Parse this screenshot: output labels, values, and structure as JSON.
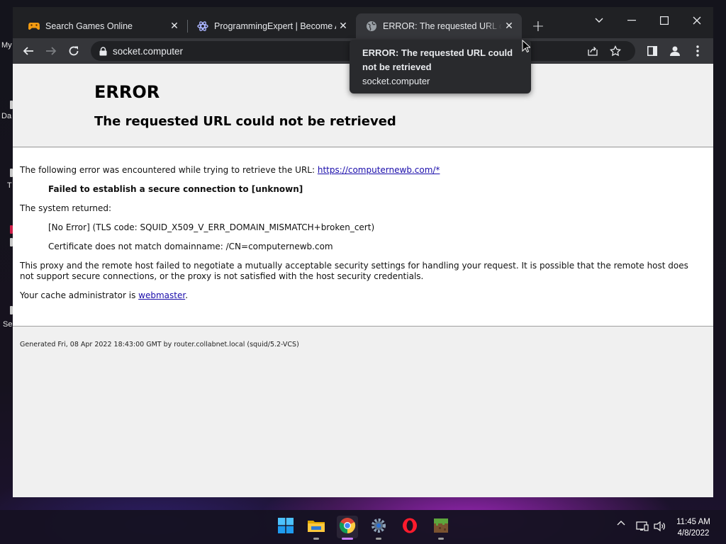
{
  "desktop": {
    "icons": [
      {
        "label": "My"
      },
      {
        "label": "Da"
      },
      {
        "label": "T"
      },
      {
        "label": "Se"
      }
    ]
  },
  "browser": {
    "tabs": [
      {
        "title": "Search Games Online",
        "icon": "gamepad-icon",
        "active": false
      },
      {
        "title": "ProgrammingExpert | Become A",
        "icon": "programmingexpert-logo-icon",
        "active": false
      },
      {
        "title": "ERROR: The requested URL could",
        "icon": "globe-icon",
        "active": true
      }
    ],
    "address_bar": {
      "url": "socket.computer"
    },
    "tooltip": {
      "title": "ERROR: The requested URL could not be retrieved",
      "url": "socket.computer"
    }
  },
  "page": {
    "heading": "ERROR",
    "subheading": "The requested URL could not be retrieved",
    "intro_text": "The following error was encountered while trying to retrieve the URL: ",
    "intro_link": "https://computernewb.com/*",
    "error_title": "Failed to establish a secure connection to [unknown]",
    "system_returned": "The system returned:",
    "tls_error": "[No Error] (TLS code: SQUID_X509_V_ERR_DOMAIN_MISMATCH+broken_cert)",
    "cert_message": "Certificate does not match domainname: /CN=computernewb.com",
    "explanation": "This proxy and the remote host failed to negotiate a mutually acceptable security settings for handling your request. It is possible that the remote host does not support secure connections, or the proxy is not satisfied with the host security credentials.",
    "admin_prefix": "Your cache administrator is ",
    "admin_link": "webmaster",
    "admin_suffix": ".",
    "footer": "Generated Fri, 08 Apr 2022 18:43:00 GMT by router.collabnet.local (squid/5.2-VCS)"
  },
  "taskbar": {
    "apps": [
      {
        "name": "start-icon"
      },
      {
        "name": "file-explorer-icon"
      },
      {
        "name": "chrome-icon",
        "active": true
      },
      {
        "name": "settings-icon"
      },
      {
        "name": "opera-icon"
      },
      {
        "name": "minecraft-icon"
      }
    ],
    "clock": {
      "time": "11:45 AM",
      "date": "4/8/2022"
    }
  },
  "colors": {
    "accent": "#c77dff",
    "link": "#1a0dab",
    "chrome_dark": "#202124",
    "chrome_toolbar": "#35363a"
  }
}
